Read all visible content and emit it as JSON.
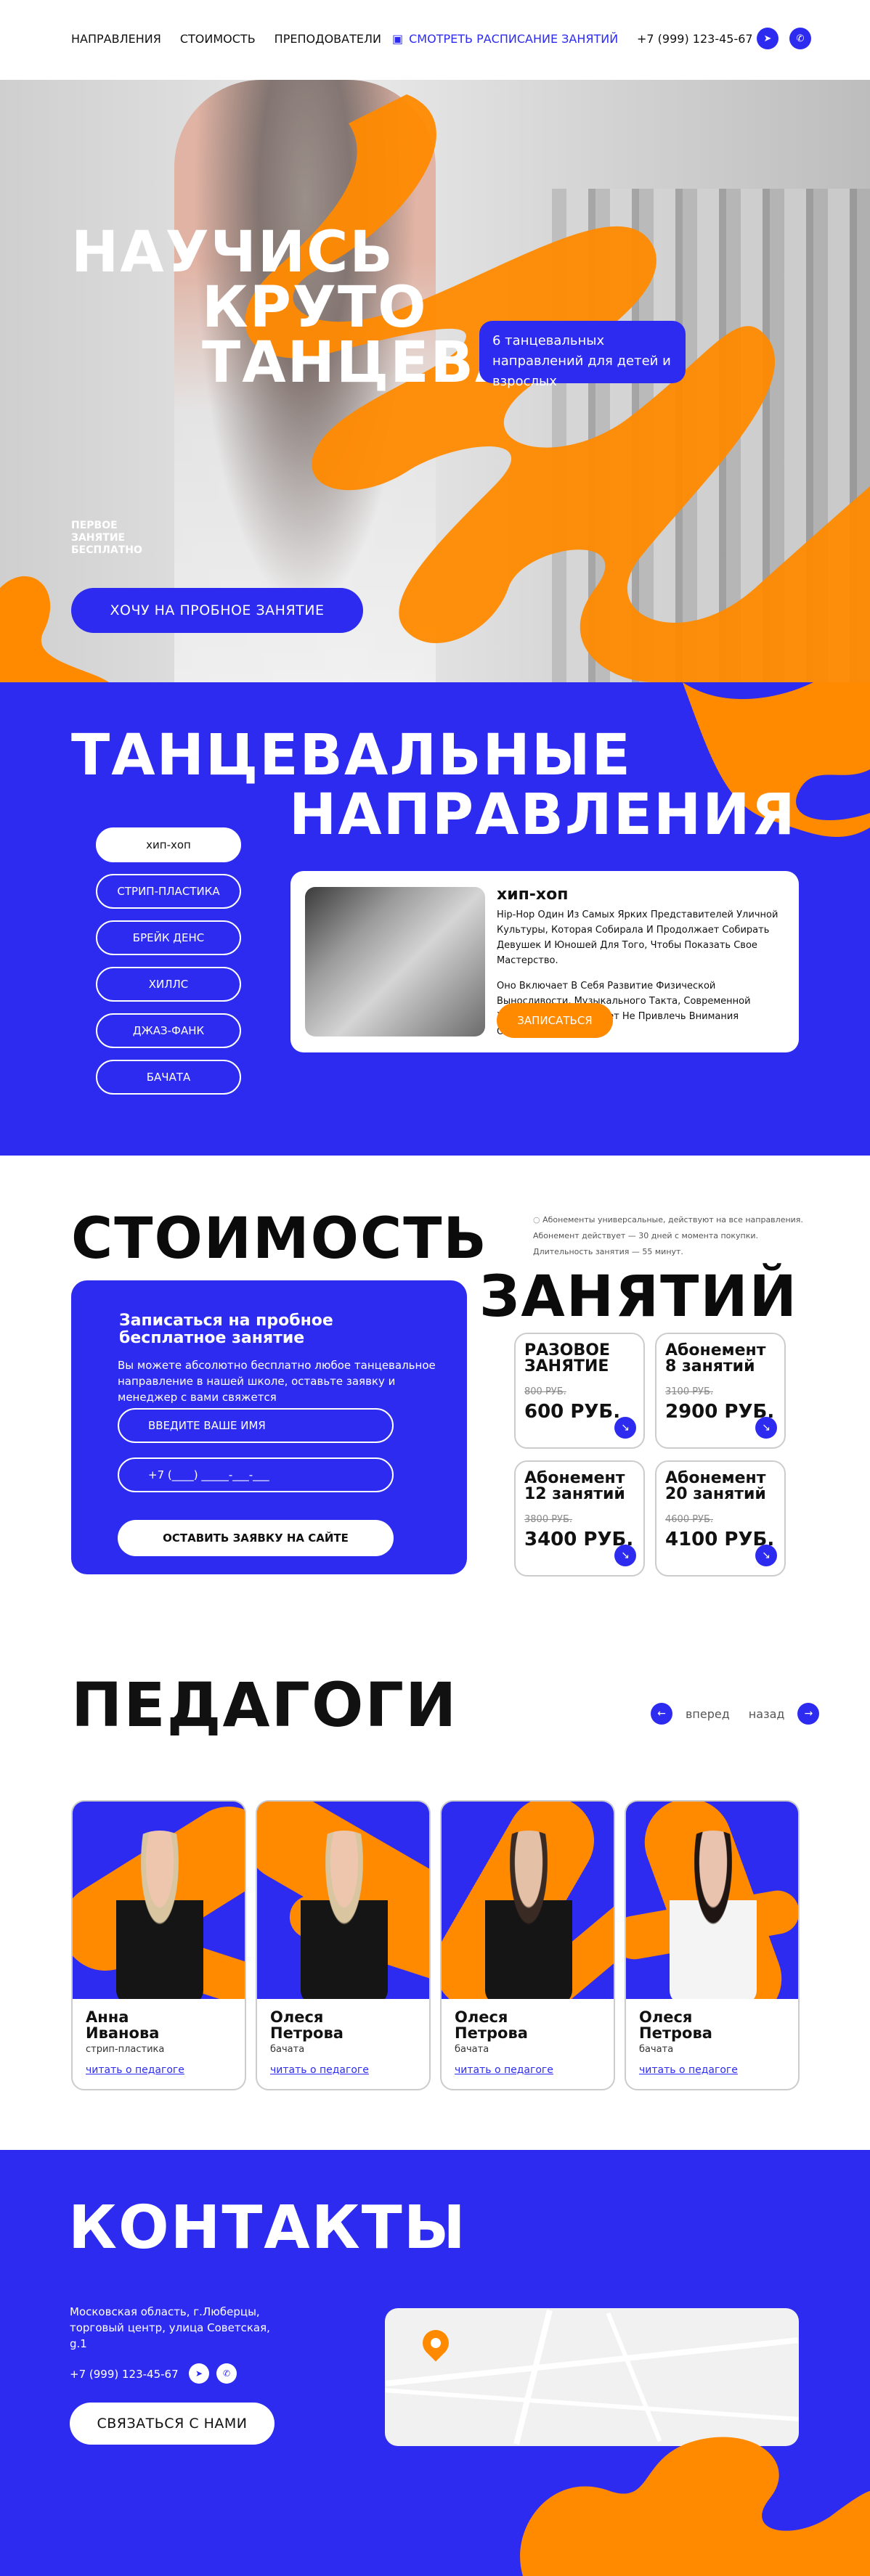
{
  "header": {
    "nav": [
      "НАПРАВЛЕНИЯ",
      "СТОИМОСТЬ",
      "ПРЕПОДОВАТЕЛИ"
    ],
    "schedule_label": "СМОТРЕТЬ РАСПИСАНИЕ ЗАНЯТИЙ",
    "phone": "+7 (999)  123-45-67",
    "telegram_icon": "telegram-icon",
    "whatsapp_icon": "whatsapp-icon"
  },
  "hero": {
    "title_line1": "НАУЧИСЬ",
    "title_line2": "КРУТО",
    "title_line3": "ТАНЦЕВАТЬ",
    "badge": "6 танцевальных направлений для детей и взрослых",
    "free_note": "ПЕРВОЕ ЗАНЯТИЕ БЕСПЛАТНО",
    "cta": "ХОЧУ НА ПРОБНОЕ ЗАНЯТИЕ"
  },
  "directions": {
    "title_line1": "ТАНЦЕВАЛЬНЫЕ",
    "title_line2": "НАПРАВЛЕНИЯ",
    "items": [
      "хип-хоп",
      "СТРИП-ПЛАСТИКА",
      "БРЕЙК ДЕНС",
      "ХИЛЛС",
      "ДЖАЗ-ФАНК",
      "БАЧАТА"
    ],
    "active_index": 0,
    "card": {
      "name": "хип-хоп",
      "text1": "Hip-Hop Один Из Самых Ярких Представителей Уличной Культуры, Которая Собирала И Продолжает Собирать Девушек И Юношей Для Того, Чтобы Показать Свое Мастерство.",
      "text2": "Оно Включает В Себя Развитие Физической Выносливости, Музыкального Такта, Современной Хореографии. Не Может Не Привлечь Внимания Окружающих.",
      "button": "ЗАПИСАТЬСЯ"
    }
  },
  "pricing": {
    "title_line1": "СТОИМОСТЬ",
    "title_line2": "ЗАНЯТИЙ",
    "note": "Абонементы универсальные, действуют на все направления. Абонемент действует — 30 дней с момента покупки. Длительность занятия — 55 минут.",
    "form": {
      "title": "Записаться на пробное бесплатное занятие",
      "subtitle": "Вы можете абсолютно бесплатно любое танцевальное направление в нашей школе, оставьте заявку и менеджер с вами свяжется",
      "name_placeholder": "ВВЕДИТЕ ВАШЕ ИМЯ",
      "phone_placeholder": "+7 (____) _____-___-___",
      "button": "ОСТАВИТЬ ЗАЯВКУ НА САЙТЕ"
    },
    "cards": [
      {
        "name": "РАЗОВОЕ ЗАНЯТИЕ",
        "old": "800 РУБ.",
        "price": "600 РУБ."
      },
      {
        "name": "Абонемент 8 занятий",
        "old": "3100 РУБ.",
        "price": "2900 РУБ."
      },
      {
        "name": "Абонемент 12 занятий",
        "old": "3800 РУБ.",
        "price": "3400 РУБ."
      },
      {
        "name": "Абонемент 20  занятий",
        "old": "4600 РУБ.",
        "price": "4100 РУБ."
      }
    ]
  },
  "teachers": {
    "title": "ПЕДАГОГИ",
    "prev": "вперед",
    "next": "назад",
    "items": [
      {
        "name": "Анна Иванова",
        "role": "стрип-пластика",
        "link": "читать о педагоге"
      },
      {
        "name": "Олеся Петрова",
        "role": "бачата",
        "link": "читать о педагоге"
      },
      {
        "name": "Олеся Петрова",
        "role": "бачата",
        "link": "читать о педагоге"
      },
      {
        "name": "Олеся Петрова",
        "role": "бачата",
        "link": "читать о педагоге"
      }
    ]
  },
  "contacts": {
    "title": "КОНТАКТЫ",
    "address": "Московская область, г.Люберцы, торговый центр, улица Советская, g.1",
    "phone": "+7 (999) 123-45-67",
    "button": "СВЯЗАТЬСЯ С НАМИ"
  },
  "colors": {
    "blue": "#2d2bf0",
    "orange": "#ff8a00",
    "black": "#0b0b0b"
  }
}
